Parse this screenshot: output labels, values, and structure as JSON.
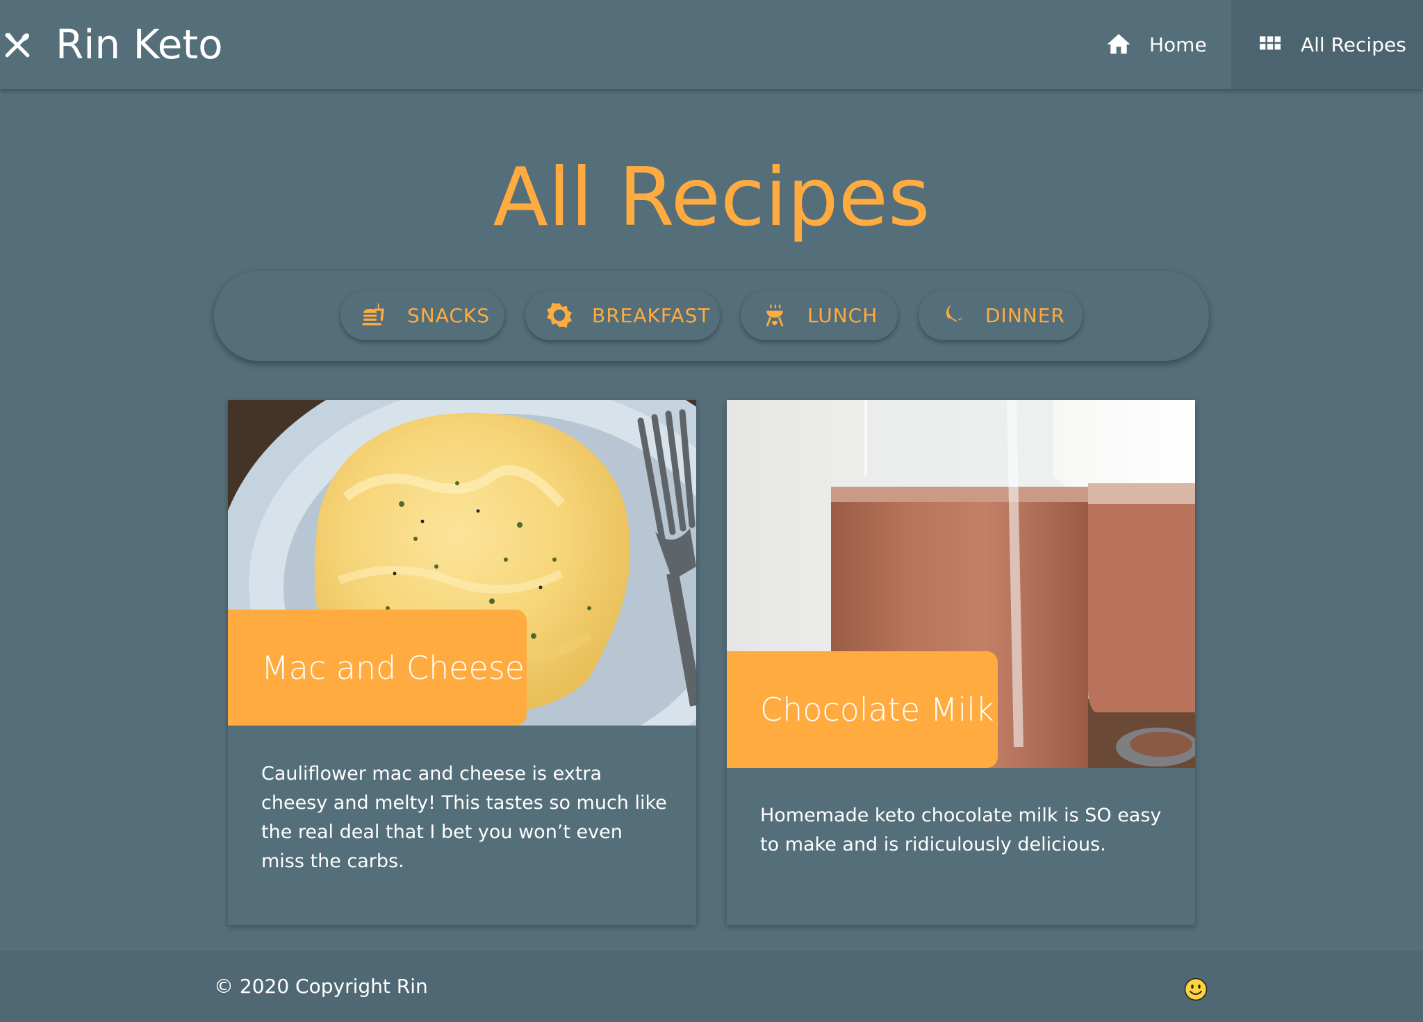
{
  "header": {
    "brand_title": "Rin Keto",
    "brand_icon": "utensils-icon",
    "nav": [
      {
        "label": "Home",
        "icon": "home-icon",
        "active": false
      },
      {
        "label": "All Recipes",
        "icon": "grid-icon",
        "active": true
      }
    ]
  },
  "main": {
    "title": "All Recipes",
    "categories": [
      {
        "label": "SNACKS",
        "icon": "burger-icon"
      },
      {
        "label": "BREAKFAST",
        "icon": "sun-icon"
      },
      {
        "label": "LUNCH",
        "icon": "grill-icon"
      },
      {
        "label": "DINNER",
        "icon": "moon-icon"
      }
    ],
    "recipes": [
      {
        "title": "Mac and Cheese",
        "description": "Cauliflower mac and cheese is extra cheesy and melty! This tastes so much like the real deal that I bet you won’t even miss the carbs."
      },
      {
        "title": "Chocolate Milk",
        "description": "Homemade keto chocolate milk is SO easy to make and is ridiculously delicious."
      }
    ]
  },
  "footer": {
    "copyright": "© 2020 Copyright Rin",
    "emoji_icon": "smiley-icon"
  },
  "colors": {
    "background": "#546e7a",
    "accent": "#ffab40",
    "text": "#ffffff"
  }
}
